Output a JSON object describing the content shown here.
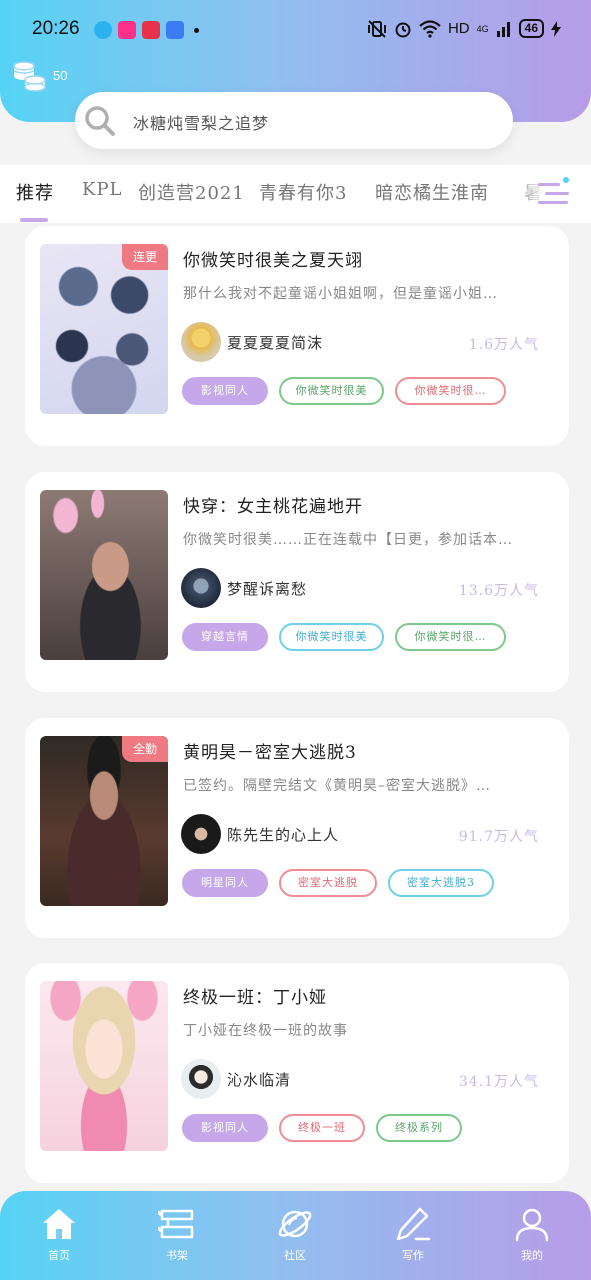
{
  "status_bar": {
    "time": "20:26",
    "network": "HD",
    "signal": "4G",
    "battery": "46"
  },
  "header": {
    "coin_count": "50"
  },
  "search": {
    "placeholder": "冰糖炖雪梨之追梦"
  },
  "tabs": [
    {
      "label": "推荐",
      "active": true
    },
    {
      "label": "KPL"
    },
    {
      "label": "创造营2021"
    },
    {
      "label": "青春有你3"
    },
    {
      "label": "暗恋橘生淮南"
    },
    {
      "label": "暑"
    }
  ],
  "stories": [
    {
      "title": "你微笑时很美之夏天翊",
      "badge": "连更",
      "description": "那什么我对不起童谣小姐姐啊，但是童谣小姐…",
      "author": "夏夏夏夏简沫",
      "popularity": "1.6万人气",
      "tags": [
        {
          "label": "影视同人",
          "style": "fill"
        },
        {
          "label": "你微笑时很美",
          "style": "green"
        },
        {
          "label": "你微笑时很…",
          "style": "red"
        }
      ]
    },
    {
      "title": "快穿：女主桃花遍地开",
      "badge": "",
      "description": "你微笑时很美……正在连载中【日更，参加话本…",
      "author": "梦醒诉离愁",
      "popularity": "13.6万人气",
      "tags": [
        {
          "label": "穿越言情",
          "style": "fill"
        },
        {
          "label": "你微笑时很美",
          "style": "cyan"
        },
        {
          "label": "你微笑时很…",
          "style": "green"
        }
      ]
    },
    {
      "title": "黄明昊－密室大逃脱3",
      "badge": "全勤",
      "description": "已签约。隔壁完结文《黄明昊–密室大逃脱》…",
      "author": "陈先生的心上人",
      "popularity": "91.7万人气",
      "tags": [
        {
          "label": "明星同人",
          "style": "fill"
        },
        {
          "label": "密室大逃脱",
          "style": "red"
        },
        {
          "label": "密室大逃脱3",
          "style": "cyan"
        }
      ]
    },
    {
      "title": "终极一班：丁小娅",
      "badge": "",
      "description": "丁小娅在终极一班的故事",
      "author": "沁水临清",
      "popularity": "34.1万人气",
      "tags": [
        {
          "label": "影视同人",
          "style": "fill"
        },
        {
          "label": "终极一班",
          "style": "red"
        },
        {
          "label": "终极系列",
          "style": "green"
        }
      ]
    }
  ],
  "bottom_nav": [
    {
      "label": "首页",
      "icon": "home-icon"
    },
    {
      "label": "书架",
      "icon": "bookshelf-icon"
    },
    {
      "label": "社区",
      "icon": "planet-icon"
    },
    {
      "label": "写作",
      "icon": "pen-icon"
    },
    {
      "label": "我的",
      "icon": "user-icon"
    }
  ],
  "colors": {
    "gradient_start": "#56d3f4",
    "gradient_end": "#b79ce8",
    "accent_purple": "#c6a7ea",
    "badge_red": "#f07a84"
  }
}
